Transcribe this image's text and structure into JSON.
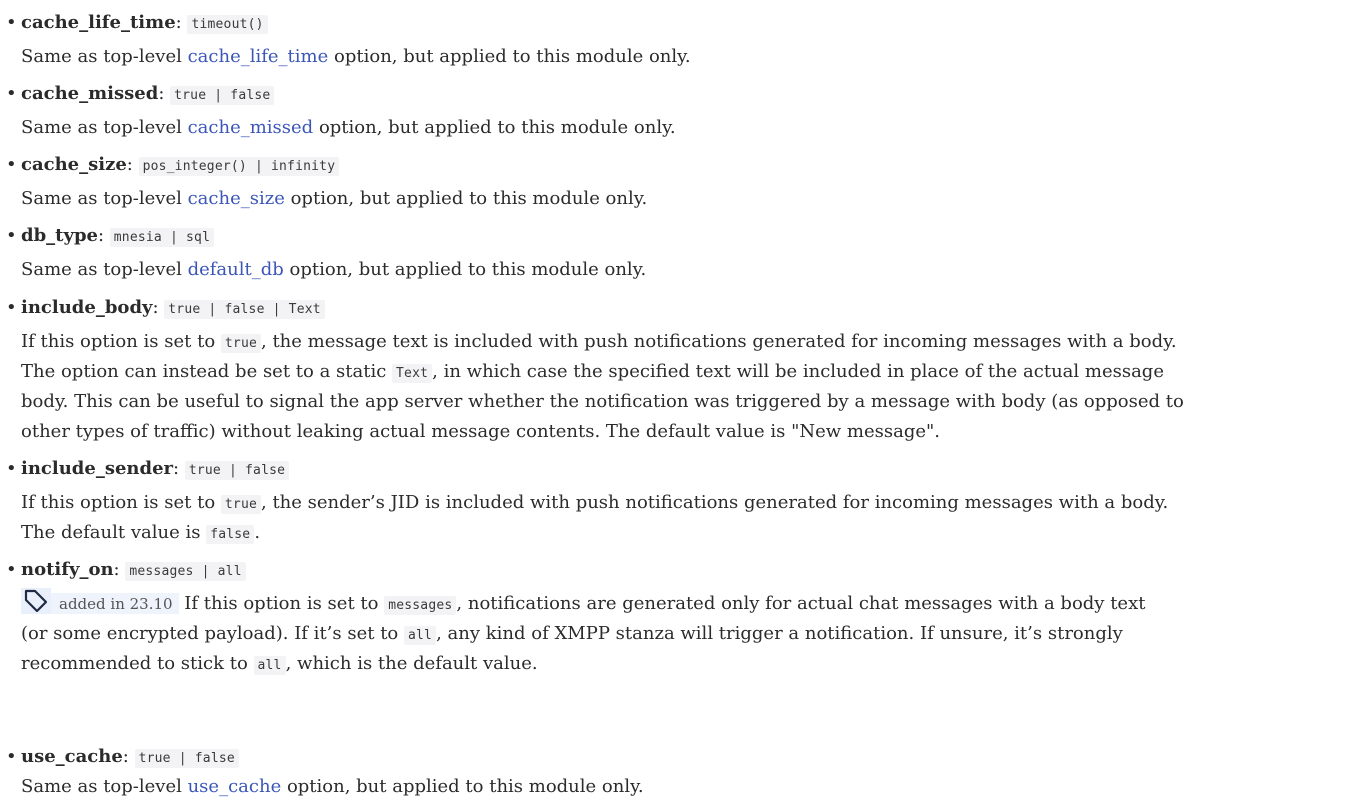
{
  "options": [
    {
      "name": "cache_life_time",
      "type": "timeout()",
      "desc_pre": "Same as top-level ",
      "link": "cache_life_time",
      "desc_post": " option, but applied to this module only."
    },
    {
      "name": "cache_missed",
      "type": "true | false",
      "desc_pre": "Same as top-level ",
      "link": "cache_missed",
      "desc_post": " option, but applied to this module only."
    },
    {
      "name": "cache_size",
      "type": "pos_integer() | infinity",
      "desc_pre": "Same as top-level ",
      "link": "cache_size",
      "desc_post": " option, but applied to this module only."
    },
    {
      "name": "db_type",
      "type": "mnesia | sql",
      "desc_pre": "Same as top-level ",
      "link": "default_db",
      "desc_post": " option, but applied to this module only."
    },
    {
      "name": "include_body",
      "type": "true | false | Text",
      "l1_a": "If this option is set to ",
      "l1_code": "true",
      "l1_b": ", the message text is included with push notifications generated for incoming messages with a body.",
      "l2_a": "The option can instead be set to a static ",
      "l2_code": "Text",
      "l2_b": ", in which case the specified text will be included in place of the actual message",
      "l3": "body. This can be useful to signal the app server whether the notification was triggered by a message with body (as opposed to",
      "l4": "other types of traffic) without leaking actual message contents. The default value is \"New message\"."
    },
    {
      "name": "include_sender",
      "type": "true | false",
      "l1_a": "If this option is set to ",
      "l1_code": "true",
      "l1_b": ", the sender’s JID is included with push notifications generated for incoming messages with a body.",
      "l2_a": "The default value is ",
      "l2_code": "false",
      "l2_b": "."
    },
    {
      "name": "notify_on",
      "type": "messages | all",
      "added_label": "added in ",
      "added_version": "23.10",
      "l1_a": " If this option is set to ",
      "l1_code": "messages",
      "l1_b": ", notifications are generated only for actual chat messages with a body text",
      "l2_a": "(or some encrypted payload). If it’s set to ",
      "l2_code": "all",
      "l2_b": ", any kind of XMPP stanza will trigger a notification. If unsure, it’s strongly",
      "l3_a": "recommended to stick to ",
      "l3_code": "all",
      "l3_b": ", which is the default value."
    },
    {
      "name": "use_cache",
      "type": "true | false",
      "desc_pre": "Same as top-level ",
      "link": "use_cache",
      "desc_post": " option, but applied to this module only."
    }
  ]
}
